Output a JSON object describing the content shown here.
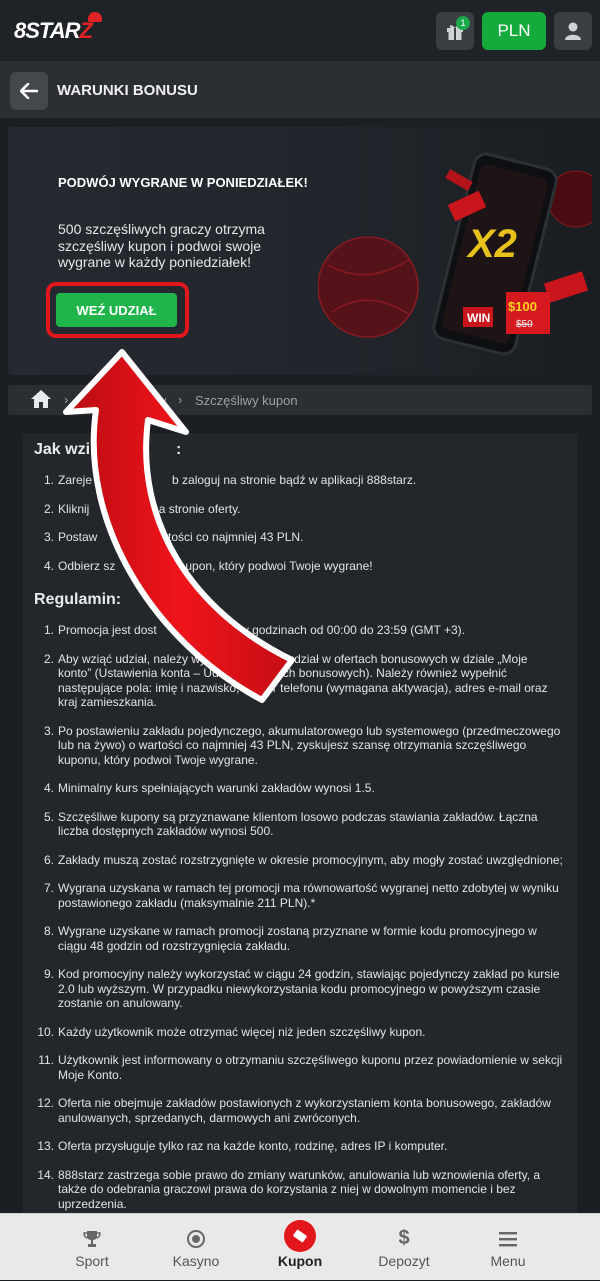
{
  "header": {
    "logo_main": "8STAR",
    "logo_tail": "Z",
    "gift_count": "1",
    "currency": "PLN"
  },
  "titlebar": {
    "title": "WARUNKI BONUSU"
  },
  "banner": {
    "headline": "PODWÓJ WYGRANE W PONIEDZIAŁEK!",
    "text": "500 szczęśliwych graczy otrzyma szczęśliwy kupon i podwoi swoje wygrane w każdy poniedziałek!",
    "cta": "WEŹ UDZIAŁ",
    "art": {
      "multiplier": "X2",
      "amount": "$100",
      "old_amount": "$50",
      "win": "WIN"
    }
  },
  "breadcrumb": {
    "current": "Szczęśliwy kupon",
    "partial": "y"
  },
  "content": {
    "howto_title": "Jak wzi",
    "howto_title_tail": ":",
    "steps": [
      {
        "n": "1.",
        "a": "Zareje",
        "b": "b zaloguj na stronie bądź w aplikacji 888starz."
      },
      {
        "n": "2.",
        "a": "Kliknij ",
        "b": "” na stronie oferty."
      },
      {
        "n": "3.",
        "a": "Postaw",
        "b": "artości co najmniej 43 PLN."
      },
      {
        "n": "4.",
        "a": "Odbierz sz",
        "b": "upon, który podwoi Twoje wygrane!"
      }
    ],
    "rules_title": "Regulamin:",
    "rules": [
      {
        "n": "1.",
        "t": "Promocja jest dost        niedziałek w godzinach od 00:00 do 23:59 (GMT +3)."
      },
      {
        "n": "2.",
        "t": "Aby wziąć udział, należy wyrazić z         na udział w ofertach bonusowych w dziale „Moje konto” (Ustawienia konta – Udział w ofertach bonusowych). Należy również wypełnić następujące pola: imię i nazwisko, numer telefonu (wymagana aktywacja), adres e-mail oraz kraj zamieszkania."
      },
      {
        "n": "3.",
        "t": "Po postawieniu zakładu pojedynczego, akumulatorowego lub systemowego (przedmeczowego lub na żywo) o wartości co najmniej 43 PLN, zyskujesz szansę otrzymania szczęśliwego kuponu, który podwoi Twoje wygrane."
      },
      {
        "n": "4.",
        "t": "Minimalny kurs spełniających warunki zakładów wynosi 1.5."
      },
      {
        "n": "5.",
        "t": "Szczęśliwe kupony są przyznawane klientom losowo podczas stawiania zakładów. Łączna liczba dostępnych zakładów wynosi 500."
      },
      {
        "n": "6.",
        "t": "Zakłady muszą zostać rozstrzygnięte w okresie promocyjnym, aby mogły zostać uwzględnione;"
      },
      {
        "n": "7.",
        "t": "Wygrana uzyskana w ramach tej promocji ma równowartość wygranej netto zdobytej w wyniku postawionego zakładu (maksymalnie 211 PLN).*"
      },
      {
        "n": "8.",
        "t": "Wygrane uzyskane w ramach promocji zostaną przyznane w formie kodu promocyjnego w ciągu 48 godzin od rozstrzygnięcia zakładu."
      },
      {
        "n": "9.",
        "t": "Kod promocyjny należy wykorzystać w ciągu 24 godzin, stawiając pojedynczy zakład po kursie 2.0 lub wyższym. W przypadku niewykorzystania kodu promocyjnego w powyższym czasie zostanie on anulowany."
      },
      {
        "n": "10.",
        "t": "Każdy użytkownik może otrzymać więcej niż jeden szczęśliwy kupon."
      },
      {
        "n": "11.",
        "t": "Użytkownik jest informowany o otrzymaniu szczęśliwego kuponu przez powiadomienie w sekcji Moje Konto."
      },
      {
        "n": "12.",
        "t": "Oferta nie obejmuje zakładów postawionych z wykorzystaniem konta bonusowego, zakładów anulowanych, sprzedanych, darmowych ani zwróconych."
      },
      {
        "n": "13.",
        "t": "Oferta przysługuje tylko raz na każde konto, rodzinę, adres IP i komputer."
      },
      {
        "n": "14.",
        "t": "888starz zastrzega sobie prawo do zmiany warunków, anulowania lub wznowienia oferty, a także do odebrania graczowi prawa do korzystania z niej w dowolnym momencie i bez uprzedzenia."
      }
    ]
  },
  "bottom_nav": {
    "items": [
      {
        "label": "Sport",
        "icon": "trophy-icon"
      },
      {
        "label": "Kasyno",
        "icon": "casino-chip-icon"
      },
      {
        "label": "Kupon",
        "icon": "coupon-icon"
      },
      {
        "label": "Depozyt",
        "icon": "dollar-icon"
      },
      {
        "label": "Menu",
        "icon": "menu-icon"
      }
    ]
  },
  "colors": {
    "accent_green": "#1fb54a",
    "accent_red": "#e3161b",
    "background": "#1b1e22"
  }
}
